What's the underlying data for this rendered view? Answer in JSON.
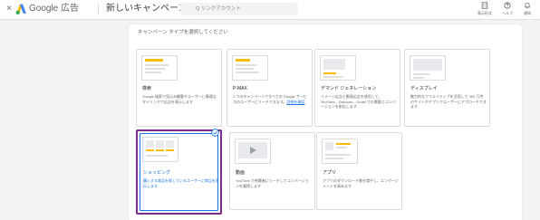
{
  "topbar": {
    "close_glyph": "×",
    "brand": "Google 広告",
    "page_title": "新しいキャンペーンを作成",
    "search_placeholder": "Q リンクアカウント",
    "tools": [
      {
        "icon": "building-icon",
        "label": "表示形式"
      },
      {
        "icon": "help-icon",
        "label": "ヘルプ"
      },
      {
        "icon": "bell-icon",
        "label": "通知"
      }
    ]
  },
  "panel": {
    "heading": "キャンペーン タイプを選択してください"
  },
  "cards": [
    {
      "title": "検索",
      "desc": "Google 検索で見込み顧客やユーザーに最適なタイミングで広告を表示します",
      "link": ""
    },
    {
      "title": "P-MAX",
      "desc": "1 つのキャンペーンですべての Google サービスのユーザーにリーチできます。",
      "link": "詳細を確認"
    },
    {
      "title": "デマンド ジェネレーション",
      "desc": "イメージ広告と動画広告を使用して、YouTube、Discover、Gmail での需要とコンバージョンを創出します",
      "link": ""
    },
    {
      "title": "ディスプレイ",
      "desc": "魅力的なクリエイティブを活用して 300 万件のサイトやアプリでユーザーにアプローチできます",
      "link": ""
    },
    {
      "title": "ショッピング",
      "desc": "購入する商品を探しているユーザーに商品を宣伝します",
      "link": "",
      "selected": true
    },
    {
      "title": "動画",
      "desc": "YouTube で視聴者にリーチしてコンバージョンを獲得します",
      "link": ""
    },
    {
      "title": "アプリ",
      "desc": "アプリのダウンロード数を増やし、エンゲージメントを高めます",
      "link": ""
    }
  ],
  "colors": {
    "accent": "#1a73e8",
    "selection": "#7b2d8b"
  }
}
